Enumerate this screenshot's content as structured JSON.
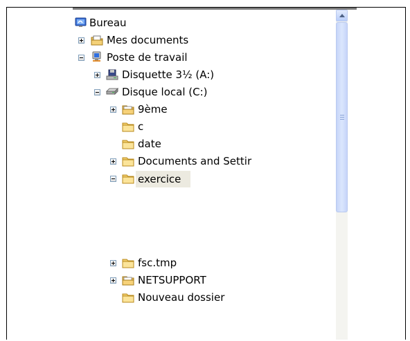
{
  "tree": {
    "items": [
      {
        "label": "Bureau",
        "icon": "desktop-icon",
        "level": 0,
        "expander": "none",
        "selected": false
      },
      {
        "label": "Mes documents",
        "icon": "my-documents-icon",
        "level": 1,
        "expander": "plus",
        "selected": false
      },
      {
        "label": "Poste de travail",
        "icon": "my-computer-icon",
        "level": 1,
        "expander": "minus",
        "selected": false
      },
      {
        "label": "Disquette 3½ (A:)",
        "icon": "floppy-drive-icon",
        "level": 2,
        "expander": "plus",
        "selected": false
      },
      {
        "label": "Disque local (C:)",
        "icon": "hard-drive-icon",
        "level": 2,
        "expander": "minus",
        "selected": false
      },
      {
        "label": "9ème",
        "icon": "folder-open-icon",
        "level": 3,
        "expander": "plus",
        "selected": false
      },
      {
        "label": "c",
        "icon": "folder-icon",
        "level": 3,
        "expander": "none",
        "selected": false
      },
      {
        "label": "date",
        "icon": "folder-icon",
        "level": 3,
        "expander": "none",
        "selected": false
      },
      {
        "label": "Documents and Settir",
        "icon": "folder-icon",
        "level": 3,
        "expander": "plus",
        "selected": false
      },
      {
        "label": "exercice",
        "icon": "folder-icon",
        "level": 3,
        "expander": "minus",
        "selected": true
      },
      {
        "label": "fsc.tmp",
        "icon": "folder-icon",
        "level": 3,
        "expander": "plus",
        "selected": false
      },
      {
        "label": "NETSUPPORT",
        "icon": "folder-open-icon",
        "level": 3,
        "expander": "plus",
        "selected": false
      },
      {
        "label": "Nouveau dossier",
        "icon": "folder-icon",
        "level": 3,
        "expander": "none",
        "selected": false
      }
    ]
  },
  "scrollbar": {
    "position": 0.0
  }
}
